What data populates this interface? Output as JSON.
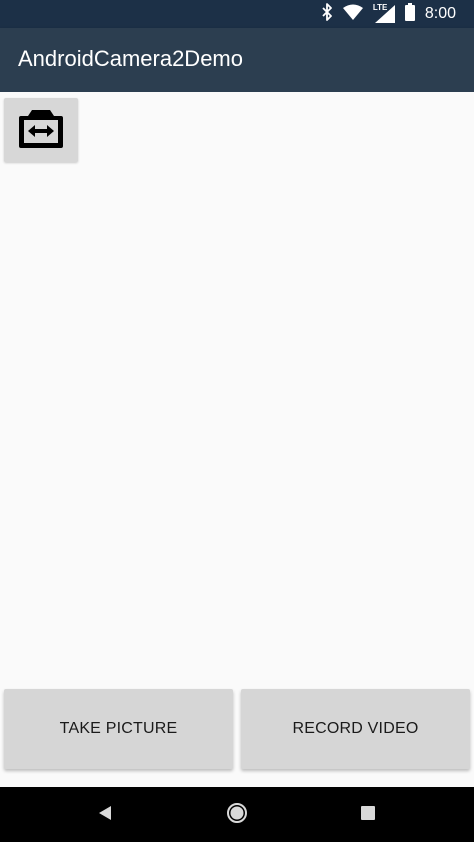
{
  "status_bar": {
    "time": "8:00",
    "network_label": "LTE",
    "icons": [
      "bluetooth-icon",
      "wifi-icon",
      "signal-icon",
      "battery-icon"
    ]
  },
  "app_bar": {
    "title": "AndroidCamera2Demo"
  },
  "camera": {
    "switch_icon": "switch-camera-icon"
  },
  "actions": {
    "take_picture_label": "TAKE PICTURE",
    "record_video_label": "RECORD VIDEO"
  },
  "nav_bar": {
    "icons": [
      "back-icon",
      "home-icon",
      "recents-icon"
    ]
  },
  "colors": {
    "status_bar": "#1c3047",
    "app_bar": "#2c3e50",
    "button": "#d6d6d6",
    "background": "#fafafa"
  }
}
